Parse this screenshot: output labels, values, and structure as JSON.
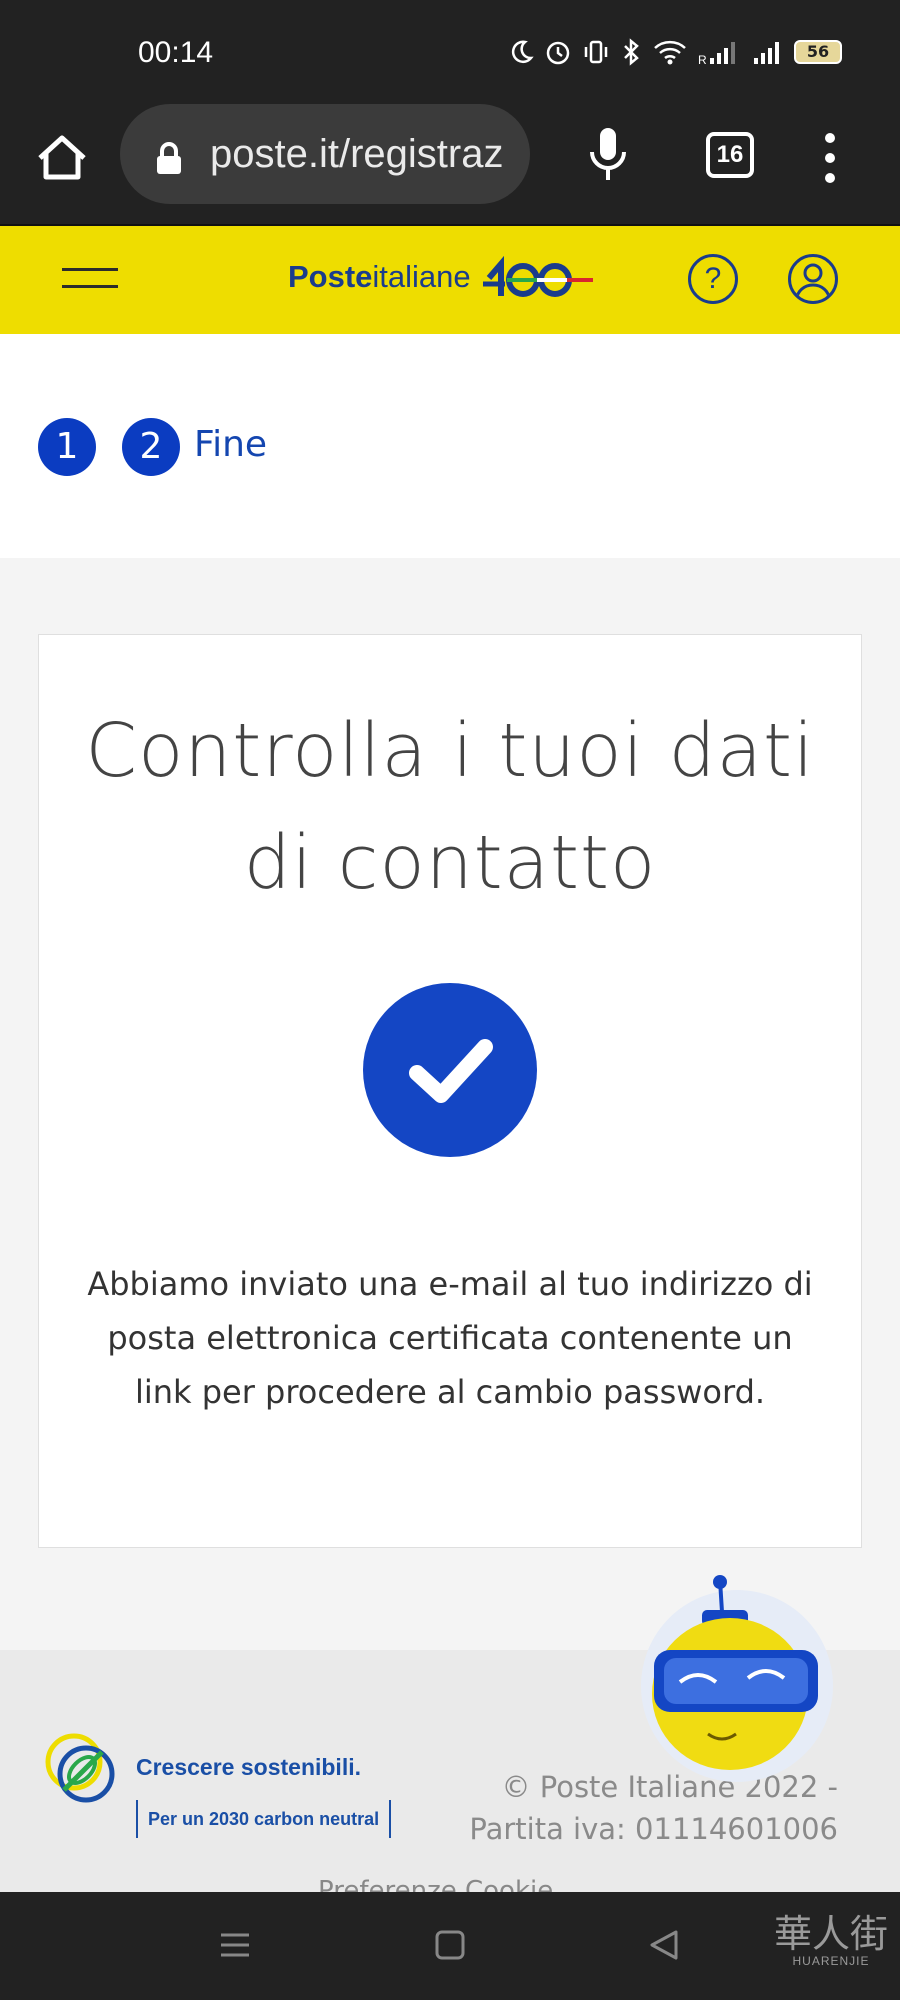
{
  "status_bar": {
    "time": "00:14",
    "battery": "56"
  },
  "browser": {
    "url": "poste.it/registraz",
    "tab_count": "16"
  },
  "site_header": {
    "logo_bold": "Poste",
    "logo_regular": "italiane"
  },
  "stepper": {
    "step1": "1",
    "step2": "2",
    "step2_label": "Fine"
  },
  "card": {
    "title": "Controlla i tuoi dati di contatto",
    "message": "Abbiamo inviato una e-mail al tuo indirizzo di posta elettronica certificata contenente un link per procedere al cambio password."
  },
  "footer": {
    "sustainability_title": "Crescere sostenibili.",
    "sustainability_subtitle": "Per un 2030 carbon neutral",
    "copyright_line1": "© Poste Italiane 2022 -",
    "copyright_line2": "Partita iva: 01114601006",
    "links": "Preferenze Cookie"
  },
  "watermark": {
    "main": "華人街",
    "sub": "HUARENJIE"
  },
  "colors": {
    "brand_yellow": "#eedd00",
    "brand_blue": "#1446c4",
    "dark_bar": "#222222"
  }
}
